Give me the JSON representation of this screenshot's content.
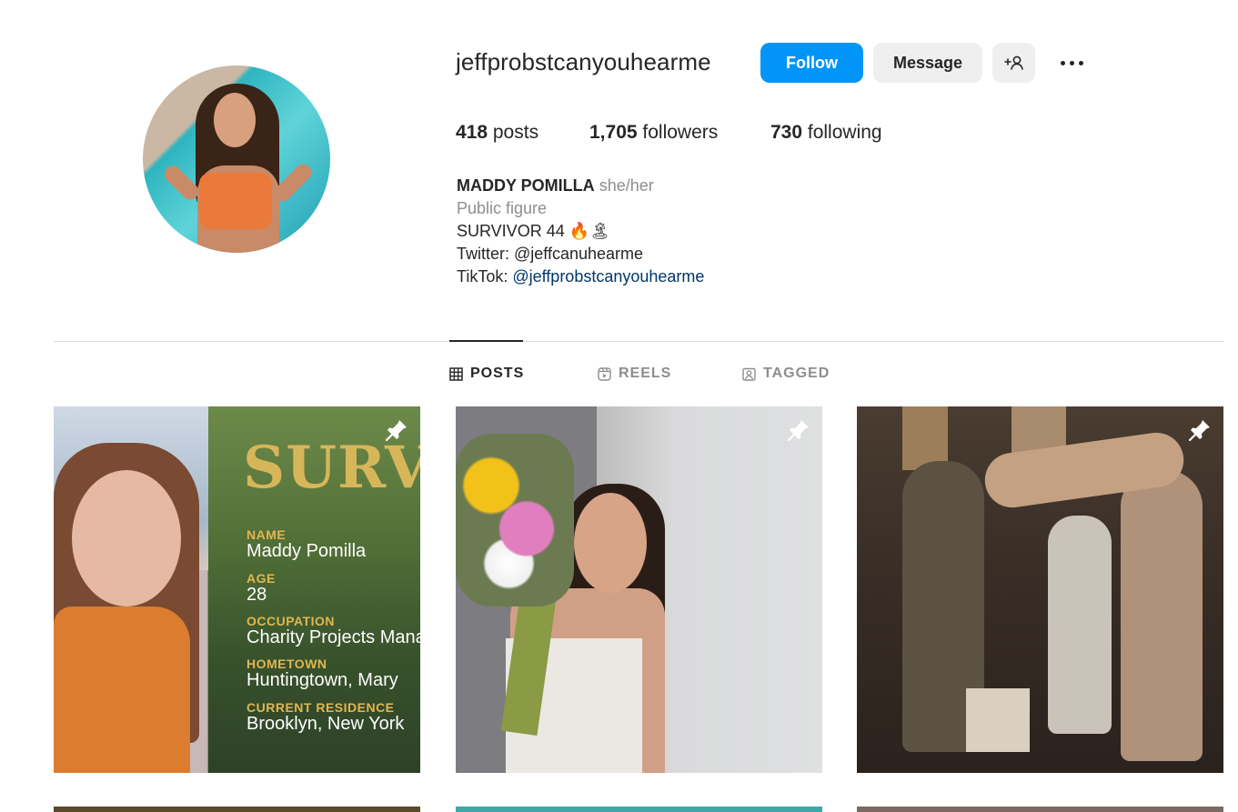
{
  "profile": {
    "username": "jeffprobstcanyouhearme",
    "buttons": {
      "follow": "Follow",
      "message": "Message",
      "suggest_icon": "+👤"
    },
    "stats": {
      "posts_count": "418",
      "posts_label": " posts",
      "followers_count": "1,705",
      "followers_label": " followers",
      "following_count": "730",
      "following_label": " following"
    },
    "bio": {
      "name": "MADDY POMILLA",
      "pronouns": "she/her",
      "category": "Public figure",
      "line1": "SURVIVOR 44 🔥🏝",
      "twitter": "Twitter: @jeffcanuhearme",
      "tiktok_prefix": "TikTok: ",
      "tiktok_handle": "@jeffprobstcanyouhearme"
    }
  },
  "tabs": [
    {
      "label": "POSTS",
      "icon": "grid-icon",
      "active": true
    },
    {
      "label": "REELS",
      "icon": "reels-icon",
      "active": false
    },
    {
      "label": "TAGGED",
      "icon": "tagged-icon",
      "active": false
    }
  ],
  "posts": [
    {
      "pinned": true,
      "overlay": {
        "title": "SURVIV",
        "fields": [
          {
            "label": "NAME",
            "value": "Maddy Pomilla"
          },
          {
            "label": "AGE",
            "value": "28"
          },
          {
            "label": "OCCUPATION",
            "value": "Charity Projects Mana"
          },
          {
            "label": "HOMETOWN",
            "value": "Huntingtown, Mary"
          },
          {
            "label": "CURRENT RESIDENCE",
            "value": "Brooklyn, New York"
          }
        ]
      }
    },
    {
      "pinned": true
    },
    {
      "pinned": true
    }
  ],
  "colors": {
    "follow_blue": "#0095f6",
    "secondary_button": "#efefef",
    "text_primary": "#262626",
    "text_secondary": "#8e8e8e",
    "link": "#00376b",
    "divider": "#dbdbdb"
  }
}
